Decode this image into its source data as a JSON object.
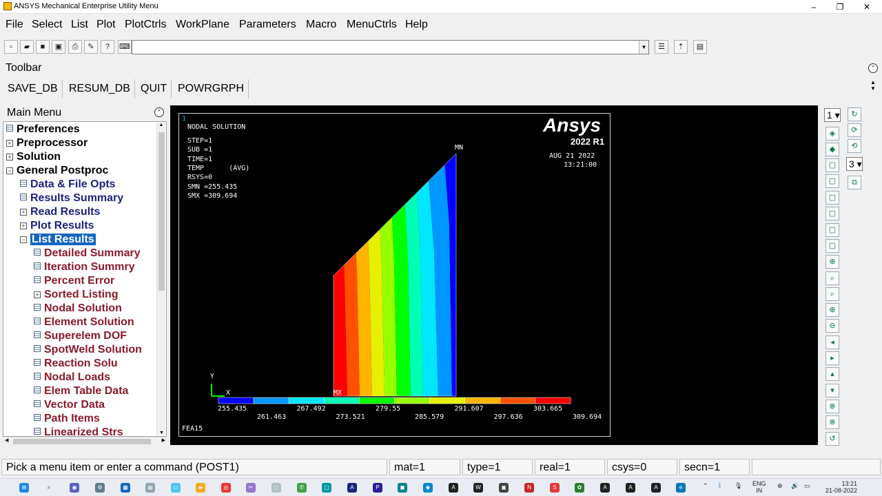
{
  "window": {
    "title": "ANSYS Mechanical Enterprise Utility Menu",
    "min": "–",
    "max": "❐",
    "close": "✕"
  },
  "menubar": [
    "File",
    "Select",
    "List",
    "Plot",
    "PlotCtrls",
    "WorkPlane",
    "Parameters",
    "Macro",
    "MenuCtrls",
    "Help"
  ],
  "command_input": {
    "value": ""
  },
  "toolbar": {
    "label": "Toolbar",
    "buttons": [
      "SAVE_DB",
      "RESUM_DB",
      "QUIT",
      "POWRGRPH"
    ]
  },
  "main_menu": {
    "label": "Main Menu",
    "items": [
      {
        "label": "Preferences",
        "level": 0,
        "icon": "leaf"
      },
      {
        "label": "Preprocessor",
        "level": 0,
        "icon": "plus"
      },
      {
        "label": "Solution",
        "level": 0,
        "icon": "plus"
      },
      {
        "label": "General Postproc",
        "level": 0,
        "icon": "minus"
      },
      {
        "label": "Data & File Opts",
        "level": 1,
        "icon": "leaf"
      },
      {
        "label": "Results Summary",
        "level": 1,
        "icon": "leaf"
      },
      {
        "label": "Read Results",
        "level": 1,
        "icon": "plus"
      },
      {
        "label": "Plot Results",
        "level": 1,
        "icon": "plus"
      },
      {
        "label": "List Results",
        "level": 1,
        "icon": "minus",
        "selected": true
      },
      {
        "label": "Detailed Summary",
        "level": 2,
        "icon": "leaf"
      },
      {
        "label": "Iteration Summry",
        "level": 2,
        "icon": "leaf"
      },
      {
        "label": "Percent Error",
        "level": 2,
        "icon": "leaf"
      },
      {
        "label": "Sorted Listing",
        "level": 2,
        "icon": "plus"
      },
      {
        "label": "Nodal Solution",
        "level": 2,
        "icon": "leaf"
      },
      {
        "label": "Element Solution",
        "level": 2,
        "icon": "leaf"
      },
      {
        "label": "Superelem DOF",
        "level": 2,
        "icon": "leaf"
      },
      {
        "label": "SpotWeld Solution",
        "level": 2,
        "icon": "leaf"
      },
      {
        "label": "Reaction Solu",
        "level": 2,
        "icon": "leaf"
      },
      {
        "label": "Nodal Loads",
        "level": 2,
        "icon": "leaf"
      },
      {
        "label": "Elem Table Data",
        "level": 2,
        "icon": "leaf"
      },
      {
        "label": "Vector Data",
        "level": 2,
        "icon": "leaf"
      },
      {
        "label": "Path Items",
        "level": 2,
        "icon": "leaf"
      },
      {
        "label": "Linearized Strs",
        "level": 2,
        "icon": "leaf"
      }
    ]
  },
  "graphics": {
    "window_number": "1",
    "header": "NODAL SOLUTION",
    "info_lines": [
      "STEP=1",
      "SUB =1",
      "TIME=1",
      "TEMP      (AVG)",
      "RSYS=0",
      "SMN =255.435",
      "SMX =309.694"
    ],
    "logo_text": "Ansys",
    "version": "2022 R1",
    "date": "AUG 21 2022",
    "time": "13:21:00",
    "mn_label": "MN",
    "mx_label": "MX",
    "axis_y": "Y",
    "axis_x": "X",
    "footer": "FEA15",
    "legend_values_top": [
      "255.435",
      "267.492",
      "279.55",
      "291.607",
      "303.665"
    ],
    "legend_values_bottom": [
      "261.463",
      "273.521",
      "285.579",
      "297.636",
      "309.694"
    ],
    "legend_colors": [
      "#0000ff",
      "#0096ff",
      "#00e6ff",
      "#00ffb4",
      "#00ff00",
      "#96ff00",
      "#e6f000",
      "#ffb400",
      "#ff5000",
      "#ff0000"
    ]
  },
  "right_bar": {
    "window_select": "1",
    "view_select": "3"
  },
  "status": {
    "prompt": "Pick a menu item or enter a command (POST1)",
    "mat": "mat=1",
    "type": "type=1",
    "real": "real=1",
    "csys": "csys=0",
    "secn": "secn=1"
  },
  "taskbar": {
    "lang": "ENG",
    "lang2": "IN",
    "time": "13:21",
    "date": "21-08-2022"
  }
}
